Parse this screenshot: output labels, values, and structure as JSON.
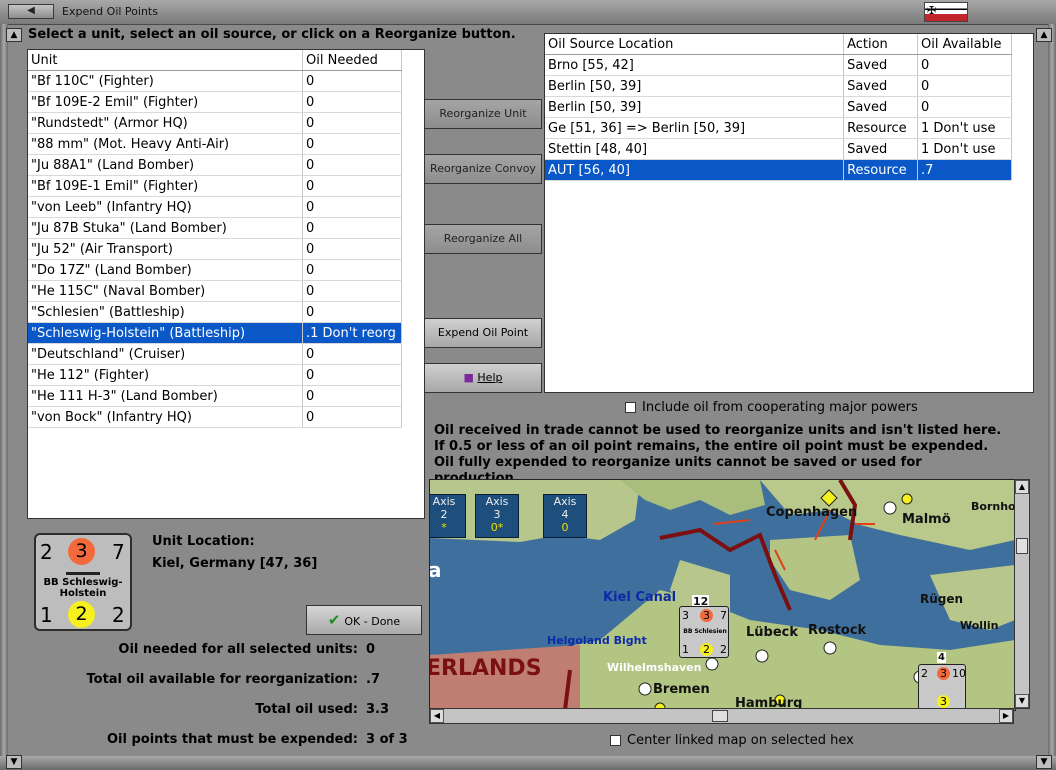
{
  "window": {
    "title": "Expend Oil Points"
  },
  "instruction": "Select a unit, select an oil source, or click on a Reorganize button.",
  "units_table": {
    "headers": [
      "Unit",
      "Oil Needed"
    ],
    "rows": [
      {
        "unit": "\"Bf 110C\" (Fighter)",
        "oil": "0"
      },
      {
        "unit": "\"Bf 109E-2 Emil\" (Fighter)",
        "oil": "0"
      },
      {
        "unit": "\"Rundstedt\" (Armor HQ)",
        "oil": "0"
      },
      {
        "unit": "\"88 mm\" (Mot. Heavy Anti-Air)",
        "oil": "0"
      },
      {
        "unit": "\"Ju 88A1\" (Land Bomber)",
        "oil": "0"
      },
      {
        "unit": "\"Bf 109E-1 Emil\" (Fighter)",
        "oil": "0"
      },
      {
        "unit": "\"von Leeb\" (Infantry HQ)",
        "oil": "0"
      },
      {
        "unit": "\"Ju 87B Stuka\" (Land Bomber)",
        "oil": "0"
      },
      {
        "unit": "\"Ju 52\" (Air Transport)",
        "oil": "0"
      },
      {
        "unit": "\"Do 17Z\" (Land Bomber)",
        "oil": "0"
      },
      {
        "unit": "\"He 115C\" (Naval Bomber)",
        "oil": "0"
      },
      {
        "unit": "\"Schlesien\" (Battleship)",
        "oil": "0"
      },
      {
        "unit": "\"Schleswig-Holstein\" (Battleship)",
        "oil": ".1 Don't reorg",
        "selected": true
      },
      {
        "unit": "\"Deutschland\" (Cruiser)",
        "oil": "0"
      },
      {
        "unit": "\"He 112\" (Fighter)",
        "oil": "0"
      },
      {
        "unit": "\"He 111 H-3\" (Land Bomber)",
        "oil": "0"
      },
      {
        "unit": "\"von Bock\" (Infantry HQ)",
        "oil": "0"
      }
    ]
  },
  "buttons": {
    "reorganize_unit": "Reorganize Unit",
    "reorganize_convoy": "Reorganize Convoy",
    "reorganize_all": "Reorganize All",
    "expend_oil_point": "Expend Oil Point",
    "help": "Help",
    "ok_done": "OK - Done"
  },
  "sources_table": {
    "headers": [
      "Oil Source Location",
      "Action",
      "Oil Available"
    ],
    "rows": [
      {
        "loc": "Brno [55, 42]",
        "action": "Saved",
        "avail": "0"
      },
      {
        "loc": "Berlin [50, 39]",
        "action": "Saved",
        "avail": "0"
      },
      {
        "loc": "Berlin [50, 39]",
        "action": "Saved",
        "avail": "0"
      },
      {
        "loc": "Ge [51, 36] => Berlin [50, 39]",
        "action": "Resource",
        "avail": "1 Don't use"
      },
      {
        "loc": "Stettin [48, 40]",
        "action": "Saved",
        "avail": "1 Don't use"
      },
      {
        "loc": "AUT [56, 40]",
        "action": "Resource",
        "avail": ".7",
        "selected": true
      }
    ]
  },
  "include_coop_label": "Include oil from cooperating major powers",
  "note": "Oil received in trade cannot be used to reorganize units and isn't listed here.  If 0.5 or less of an oil point remains, the entire oil point must be expended.   Oil fully expended to reorganize units cannot be saved or used for production.",
  "unit_counter": {
    "top_left": "2",
    "top_mid": "3",
    "top_right": "7",
    "bot_left": "1",
    "bot_mid": "2",
    "bot_right": "2",
    "name": "BB Schleswig-Holstein",
    "top_mid_color": "#f26a3b",
    "bot_mid_color": "#f5f01e"
  },
  "unit_location": {
    "label": "Unit Location:",
    "value": "Kiel, Germany [47, 36]"
  },
  "stats": [
    {
      "label": "Oil needed for all selected units:",
      "value": "0"
    },
    {
      "label": "Total oil available for reorganization:",
      "value": ".7"
    },
    {
      "label": "Total oil used:",
      "value": "3.3"
    },
    {
      "label": "Oil points that must be expended:",
      "value": "3 of 3"
    }
  ],
  "map": {
    "labels": {
      "copenhagen": "Copenhagen",
      "malmo": "Malmö",
      "bornholm": "Bornho",
      "kiel_canal": "Kiel Canal",
      "rugen": "Rügen",
      "lubeck": "Lübeck",
      "rostock": "Rostock",
      "helgoland": "Helgoland Bight",
      "wollin": "Wollin",
      "wilhelmshaven": "Wilhelmshaven",
      "bremen": "Bremen",
      "hamburg": "Hamburg",
      "netherlands": "ERLANDS",
      "edge_a": "a"
    },
    "axis_boxes": [
      {
        "label": "Axis",
        "num": "2",
        "sub": "*"
      },
      {
        "label": "Axis",
        "num": "3",
        "sub": "0*"
      },
      {
        "label": "Axis",
        "num": "4",
        "sub": "0"
      }
    ],
    "stack_count": "12",
    "stack_count2": "4",
    "map_counter": {
      "tl": "3",
      "tm": "3",
      "tr": "7",
      "bl": "1",
      "bm": "2",
      "br": "2",
      "name": "BB Schlesien"
    },
    "map_counter2": {
      "tl": "2",
      "tm": "3",
      "tr": "10",
      "bm": "3"
    },
    "colors": {
      "sea": "#3f6f9c",
      "land": "#b7c68a",
      "border": "#7a1010"
    }
  },
  "center_map_label": "Center linked map on selected hex",
  "colors": {
    "selection": "#0a58c7",
    "window": "#8a8a8a"
  }
}
